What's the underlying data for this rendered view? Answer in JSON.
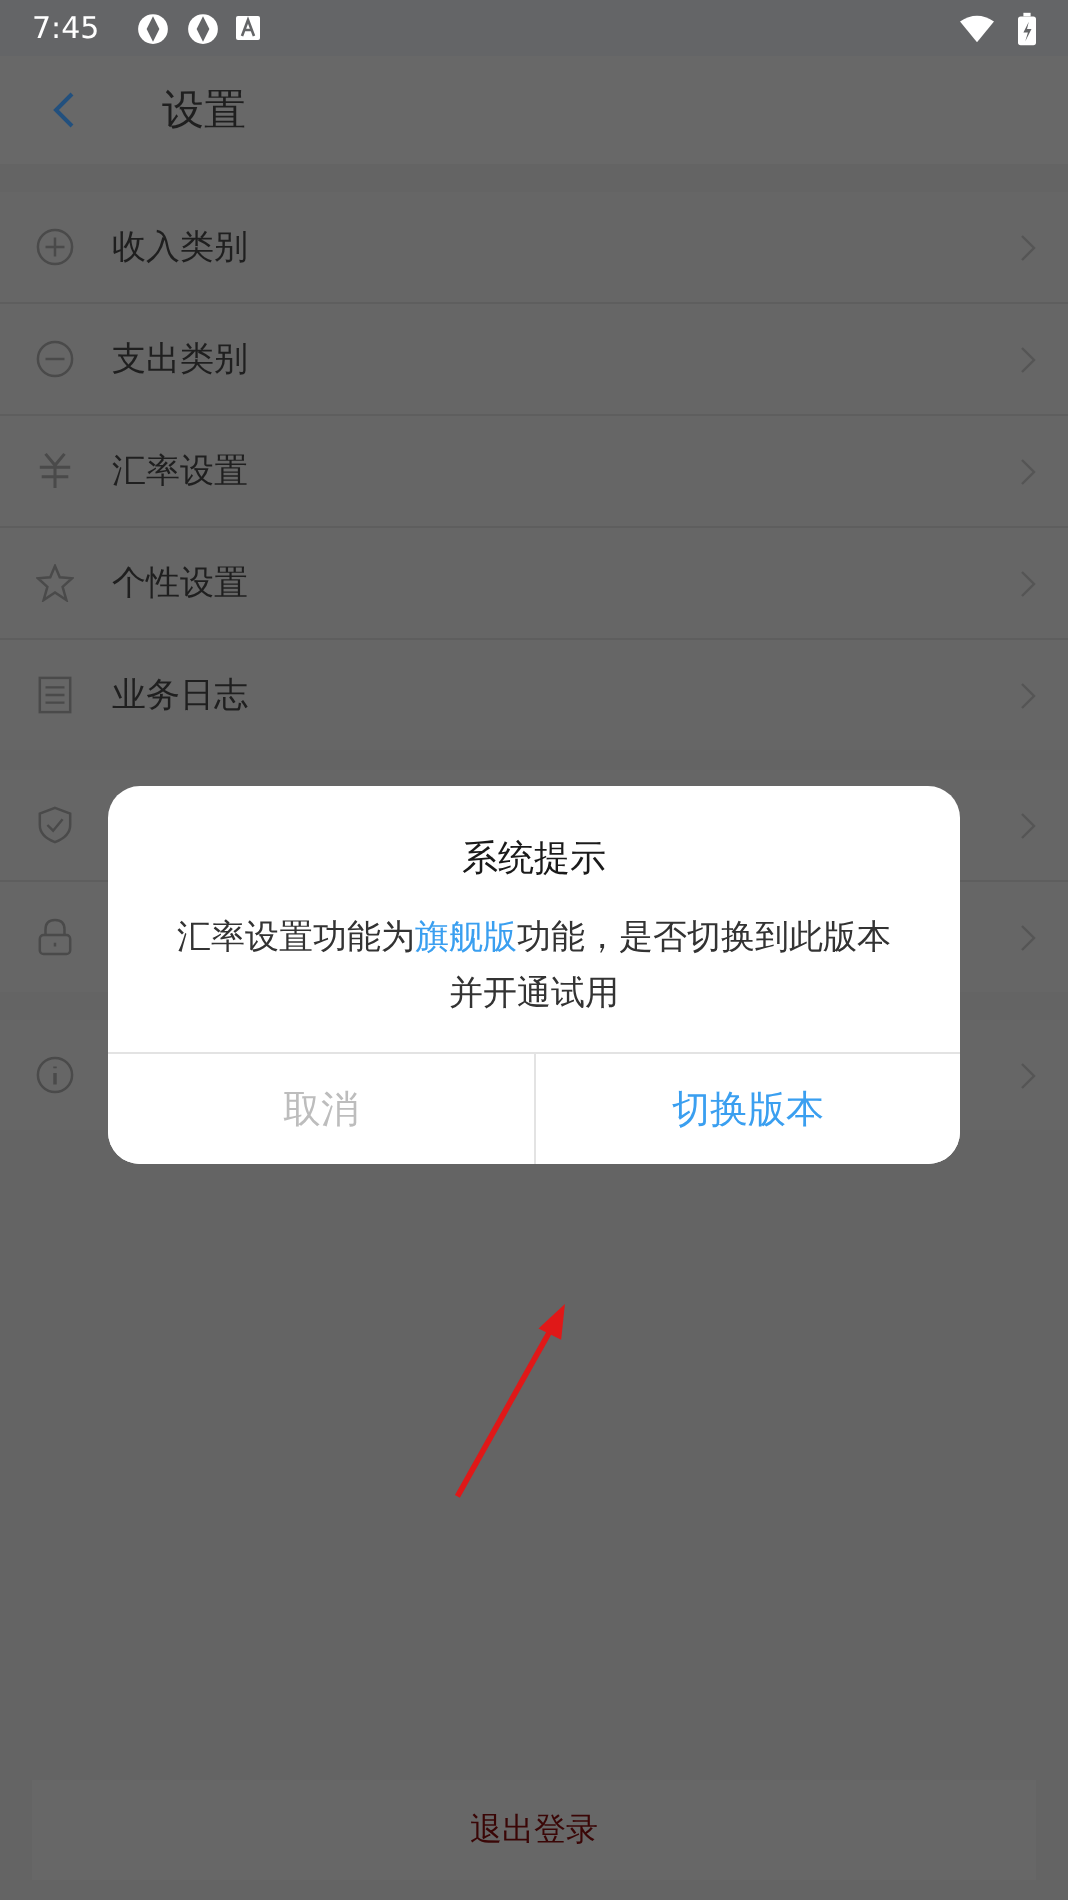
{
  "status_bar": {
    "time": "7:45"
  },
  "header": {
    "title": "设置"
  },
  "settings": [
    {
      "label": "收入类别"
    },
    {
      "label": "支出类别"
    },
    {
      "label": "汇率设置"
    },
    {
      "label": "个性设置"
    },
    {
      "label": "业务日志"
    }
  ],
  "dialog": {
    "title": "系统提示",
    "message": "汇率设置功能为**旗舰版**功能，是否切换到此版本并开通试用",
    "buttons": [
      {
        "label": "取消",
        "kind": "cancel"
      },
      {
        "label": "切换版本",
        "kind": "confirm"
      }
    ]
  },
  "logout_button": {
    "label": "退出登录"
  }
}
